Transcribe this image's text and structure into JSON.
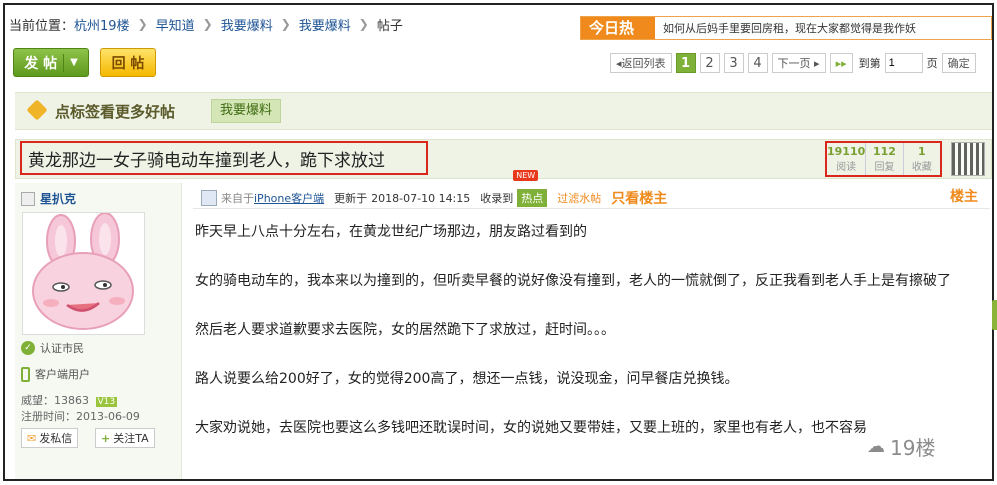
{
  "breadcrumb": {
    "label": "当前位置：",
    "items": [
      "杭州19楼",
      "早知道",
      "我要爆料",
      "我要爆料",
      "帖子"
    ]
  },
  "today_hot": {
    "badge": "今日热点",
    "text": "如何从后妈手里要回房租，现在大家都觉得是我作妖"
  },
  "toolbar": {
    "post_label": "发 帖",
    "reply_label": "回 帖"
  },
  "pager": {
    "back_label": "◂返回列表",
    "pages": [
      "1",
      "2",
      "3",
      "4"
    ],
    "current": "1",
    "next_label": "下一页 ▸",
    "last_label": "▸▸",
    "goto_label": "到第",
    "goto_value": "1",
    "page_unit": "页",
    "confirm_label": "确定"
  },
  "tagbar": {
    "label": "点标签看更多好帖",
    "tag": "我要爆料"
  },
  "thread": {
    "title": "黄龙那边一女子骑电动车撞到老人，跪下求放过",
    "stats": [
      {
        "value": "19110",
        "label": "阅读"
      },
      {
        "value": "112",
        "label": "回复"
      },
      {
        "value": "1",
        "label": "收藏"
      }
    ]
  },
  "author": {
    "name": "星扒克",
    "verified": "认证市民",
    "client": "客户端用户",
    "reputation_label": "威望：",
    "reputation": "13863",
    "level": "V13",
    "register_label": "注册时间：",
    "register_date": "2013-06-09",
    "message_button": "发私信",
    "follow_button": "关注TA"
  },
  "post": {
    "from_label": "来自于",
    "from_client": "iPhone客户端",
    "updated_label": "更新于",
    "updated_time": "2018-07-10 14:15",
    "collected_label": "收录到",
    "hot_tag": "热点",
    "new_badge": "NEW",
    "filter_label": "过滤水帖",
    "only_op_label": "只看楼主",
    "floor": "楼主",
    "paragraphs": [
      "昨天早上八点十分左右，在黄龙世纪广场那边，朋友路过看到的",
      "女的骑电动车的，我本来以为撞到的，但听卖早餐的说好像没有撞到，老人的一慌就倒了，反正我看到老人手上是有擦破了",
      "然后老人要求道歉要求去医院，女的居然跪下了求放过，赶时间。。。",
      "路人说要么给200好了，女的觉得200高了，想还一点钱，说没现金，问早餐店兑换钱。",
      "大家劝说她，去医院也要这么多钱吧还耽误时间，女的说她又要带娃，又要上班的，家里也有老人，也不容易"
    ]
  },
  "watermark": "19楼"
}
